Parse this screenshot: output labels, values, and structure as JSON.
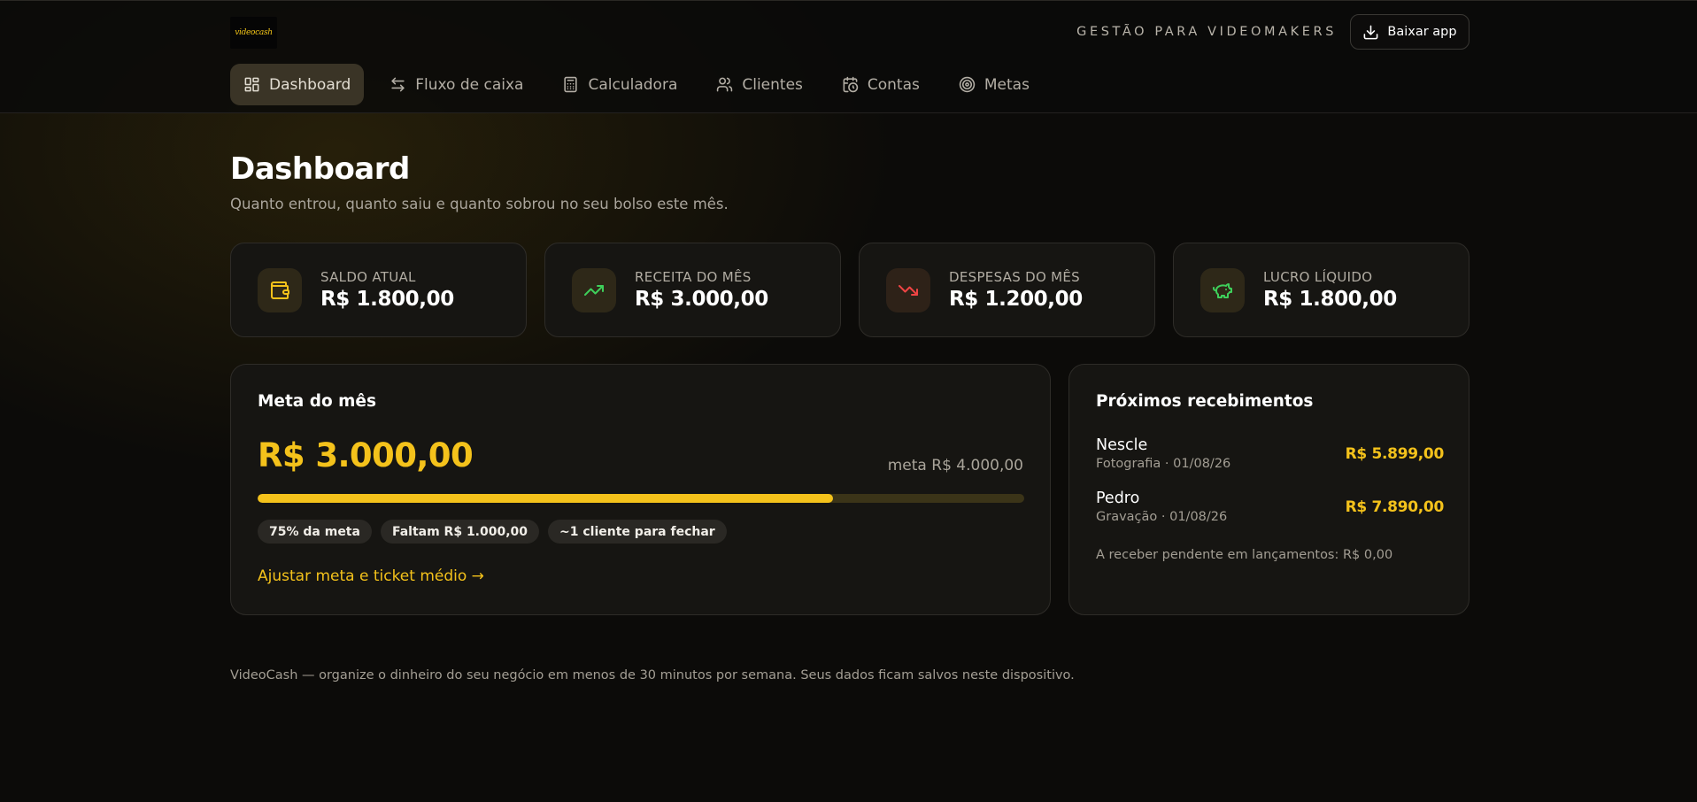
{
  "header": {
    "logo_text": "videocash",
    "tagline": "GESTÃO PARA VIDEOMAKERS",
    "download_label": "Baixar app"
  },
  "nav": {
    "items": [
      {
        "label": "Dashboard",
        "icon": "dashboard-icon",
        "active": true
      },
      {
        "label": "Fluxo de caixa",
        "icon": "arrows-exchange-icon"
      },
      {
        "label": "Calculadora",
        "icon": "calculator-icon"
      },
      {
        "label": "Clientes",
        "icon": "users-icon"
      },
      {
        "label": "Contas",
        "icon": "calendar-clock-icon"
      },
      {
        "label": "Metas",
        "icon": "target-icon"
      }
    ]
  },
  "page": {
    "title": "Dashboard",
    "subtitle": "Quanto entrou, quanto saiu e quanto sobrou no seu bolso este mês."
  },
  "stats": [
    {
      "label": "SALDO ATUAL",
      "value": "R$ 1.800,00",
      "icon": "wallet-icon"
    },
    {
      "label": "RECEITA DO MÊS",
      "value": "R$ 3.000,00",
      "icon": "trending-up-icon"
    },
    {
      "label": "DESPESAS DO MÊS",
      "value": "R$ 1.200,00",
      "icon": "trending-down-icon"
    },
    {
      "label": "LUCRO LÍQUIDO",
      "value": "R$ 1.800,00",
      "icon": "piggy-bank-icon"
    }
  ],
  "goal": {
    "title": "Meta do mês",
    "amount": "R$ 3.000,00",
    "target": "meta R$ 4.000,00",
    "progress_percent": 75,
    "chips": [
      "75% da meta",
      "Faltam R$ 1.000,00",
      "~1 cliente para fechar"
    ],
    "link": "Ajustar meta e ticket médio →"
  },
  "upcoming": {
    "title": "Próximos recebimentos",
    "items": [
      {
        "name": "Nescle",
        "meta": "Fotografia · 01/08/26",
        "amount": "R$ 5.899,00"
      },
      {
        "name": "Pedro",
        "meta": "Gravação · 01/08/26",
        "amount": "R$ 7.890,00"
      }
    ],
    "pending": "A receber pendente em lançamentos: R$ 0,00"
  },
  "footer": {
    "text": "VideoCash — organize o dinheiro do seu negócio em menos de 30 minutos por semana. Seus dados ficam salvos neste dispositivo."
  },
  "colors": {
    "accent": "#f4c21b",
    "up": "#3ecf5a",
    "down": "#ef4444",
    "background": "#0c0b09"
  }
}
